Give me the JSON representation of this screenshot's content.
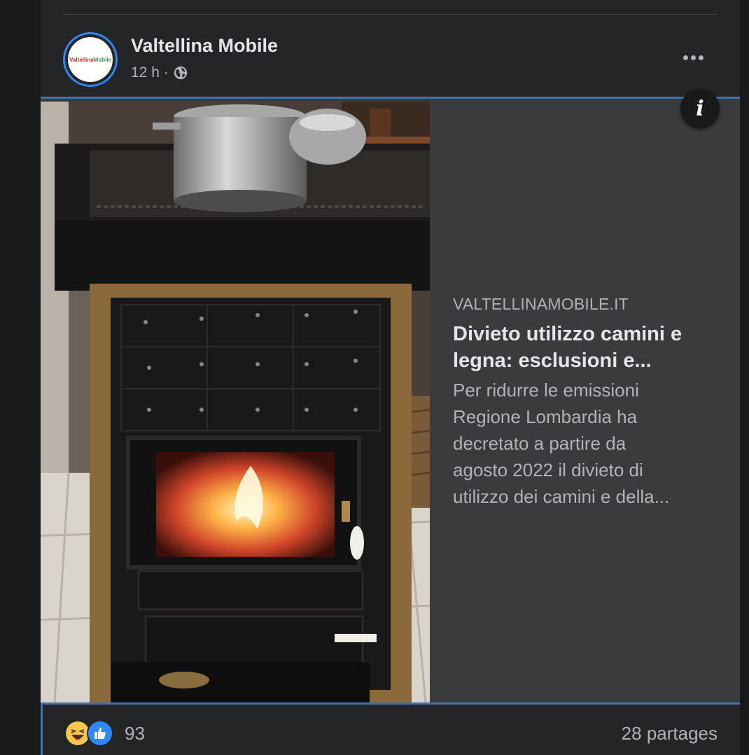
{
  "post": {
    "page_name": "Valtellina Mobile",
    "avatar_logo_text": [
      "Valtellina",
      "Mobile"
    ],
    "time": "12 h",
    "separator": "·",
    "audience_icon": "globe-icon",
    "more_icon": "more-options-icon"
  },
  "link_preview": {
    "domain": "VALTELLINAMOBILE.IT",
    "headline_lines": [
      "Divieto utilizzo camini e",
      "legna: esclusioni e..."
    ],
    "description_lines": [
      "Per ridurre le emissioni",
      "Regione Lombardia ha",
      "decretato a partire da",
      "agosto 2022 il divieto di",
      "utilizzo dei camini e della..."
    ],
    "info_icon_text": "i",
    "image_subject": "wood-burning stove with pot on top"
  },
  "engagement": {
    "reaction_icons": [
      "haha-reaction-icon",
      "like-reaction-icon"
    ],
    "reaction_count": "93",
    "shares": "28 partages"
  },
  "colors": {
    "background": "#18191a",
    "card": "#242526",
    "preview": "#3a3b3c",
    "accent_blue": "#2d88ff",
    "text_primary": "#e4e6eb",
    "text_secondary": "#b0b3b8"
  }
}
